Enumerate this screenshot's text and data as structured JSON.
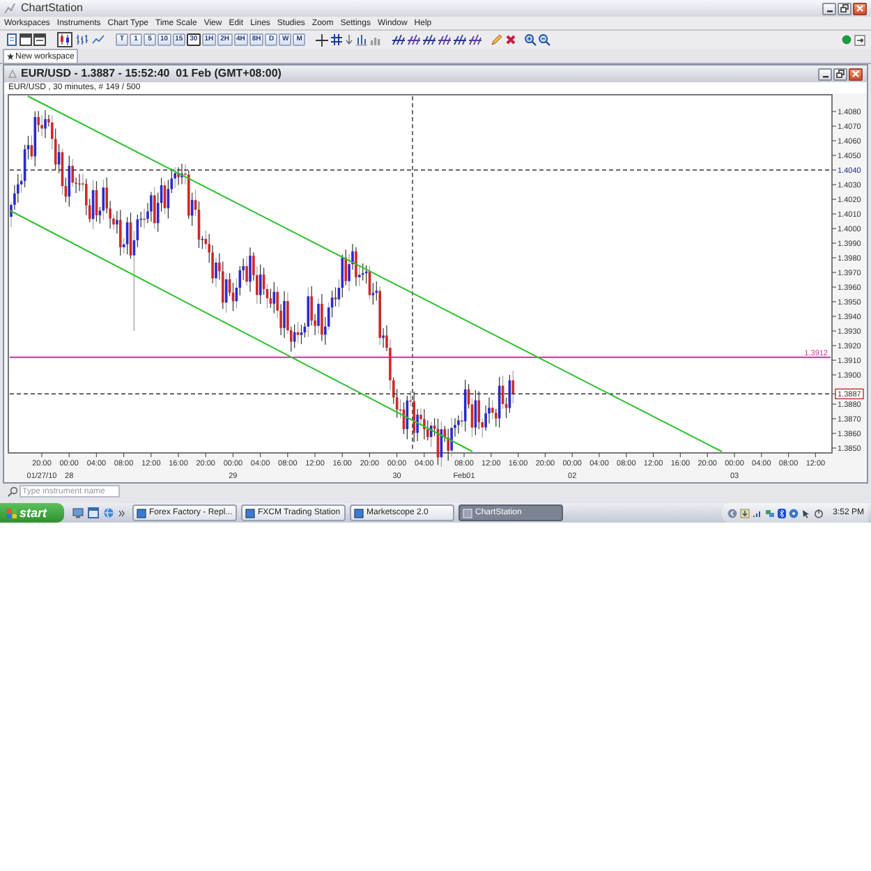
{
  "window": {
    "title": "ChartStation"
  },
  "menu": [
    "Workspaces",
    "Instruments",
    "Chart Type",
    "Time Scale",
    "View",
    "Edit",
    "Lines",
    "Studies",
    "Zoom",
    "Settings",
    "Window",
    "Help"
  ],
  "toolbar": {
    "chart_types": [
      {
        "kind": "candle",
        "selected": true
      },
      {
        "kind": "bar",
        "selected": false
      },
      {
        "kind": "line",
        "selected": false
      }
    ],
    "timeframes": [
      {
        "label": "T",
        "selected": false
      },
      {
        "label": "1",
        "selected": false
      },
      {
        "label": "5",
        "selected": false
      },
      {
        "label": "10",
        "selected": false
      },
      {
        "label": "15",
        "selected": false
      },
      {
        "label": "30",
        "selected": true
      },
      {
        "label": "1H",
        "selected": false
      },
      {
        "label": "2H",
        "selected": false
      },
      {
        "label": "4H",
        "selected": false
      },
      {
        "label": "8H",
        "selected": false
      },
      {
        "label": "D",
        "selected": false
      },
      {
        "label": "W",
        "selected": false
      },
      {
        "label": "M",
        "selected": false
      }
    ]
  },
  "tabs": [
    {
      "label": "New workspace",
      "selected": true
    }
  ],
  "chart_window": {
    "title": "EUR/USD - 1.3887 - 15:52:40  01 Feb (GMT+08:00)",
    "caption": "EUR/USD , 30 minutes, # 149 / 500",
    "price_axis": [
      {
        "label": "1.4080",
        "kind": "tick"
      },
      {
        "label": "1.4070",
        "kind": "tick"
      },
      {
        "label": "1.4060",
        "kind": "tick"
      },
      {
        "label": "1.4050",
        "kind": "tick"
      },
      {
        "label": "1.4040",
        "kind": "marked"
      },
      {
        "label": "1.4030",
        "kind": "tick"
      },
      {
        "label": "1.4020",
        "kind": "tick"
      },
      {
        "label": "1.4010",
        "kind": "tick"
      },
      {
        "label": "1.4000",
        "kind": "tick"
      },
      {
        "label": "1.3990",
        "kind": "tick"
      },
      {
        "label": "1.3980",
        "kind": "tick"
      },
      {
        "label": "1.3970",
        "kind": "tick"
      },
      {
        "label": "1.3960",
        "kind": "tick"
      },
      {
        "label": "1.3950",
        "kind": "tick"
      },
      {
        "label": "1.3940",
        "kind": "tick"
      },
      {
        "label": "1.3930",
        "kind": "tick"
      },
      {
        "label": "1.3920",
        "kind": "tick"
      },
      {
        "label": "1.3910",
        "kind": "tick"
      },
      {
        "label": "1.3900",
        "kind": "tick"
      },
      {
        "label": "1.3887",
        "kind": "current"
      },
      {
        "label": "1.3880",
        "kind": "tick"
      },
      {
        "label": "1.3870",
        "kind": "tick"
      },
      {
        "label": "1.3860",
        "kind": "tick"
      },
      {
        "label": "1.3850",
        "kind": "tick"
      }
    ],
    "level_label": "1.3912",
    "time_axis": [
      {
        "time": "20:00",
        "date": "01/27/10"
      },
      {
        "time": "00:00",
        "date": "28"
      },
      {
        "time": "04:00"
      },
      {
        "time": "08:00"
      },
      {
        "time": "12:00"
      },
      {
        "time": "16:00"
      },
      {
        "time": "20:00"
      },
      {
        "time": "00:00",
        "date": "29"
      },
      {
        "time": "04:00"
      },
      {
        "time": "08:00"
      },
      {
        "time": "12:00"
      },
      {
        "time": "16:00"
      },
      {
        "time": "20:00"
      },
      {
        "time": "00:00",
        "date": "30"
      },
      {
        "time": "04:00"
      },
      {
        "time": "08:00",
        "date": "Feb01"
      },
      {
        "time": "12:00"
      },
      {
        "time": "16:00"
      },
      {
        "time": "20:00"
      },
      {
        "time": "00:00",
        "date": "02"
      },
      {
        "time": "04:00"
      },
      {
        "time": "08:00"
      },
      {
        "time": "12:00"
      },
      {
        "time": "16:00"
      },
      {
        "time": "20:00"
      },
      {
        "time": "00:00",
        "date": "03"
      },
      {
        "time": "04:00"
      },
      {
        "time": "08:00"
      },
      {
        "time": "12:00"
      }
    ]
  },
  "search": {
    "placeholder": "Type instrument name"
  },
  "taskbar": {
    "start": "start",
    "tasks": [
      {
        "label": "Forex Factory - Repl...",
        "selected": false
      },
      {
        "label": "FXCM Trading Station",
        "selected": false
      },
      {
        "label": "Marketscope 2.0",
        "selected": false
      },
      {
        "label": "ChartStation",
        "selected": true
      }
    ],
    "clock": "3:52 PM"
  }
}
